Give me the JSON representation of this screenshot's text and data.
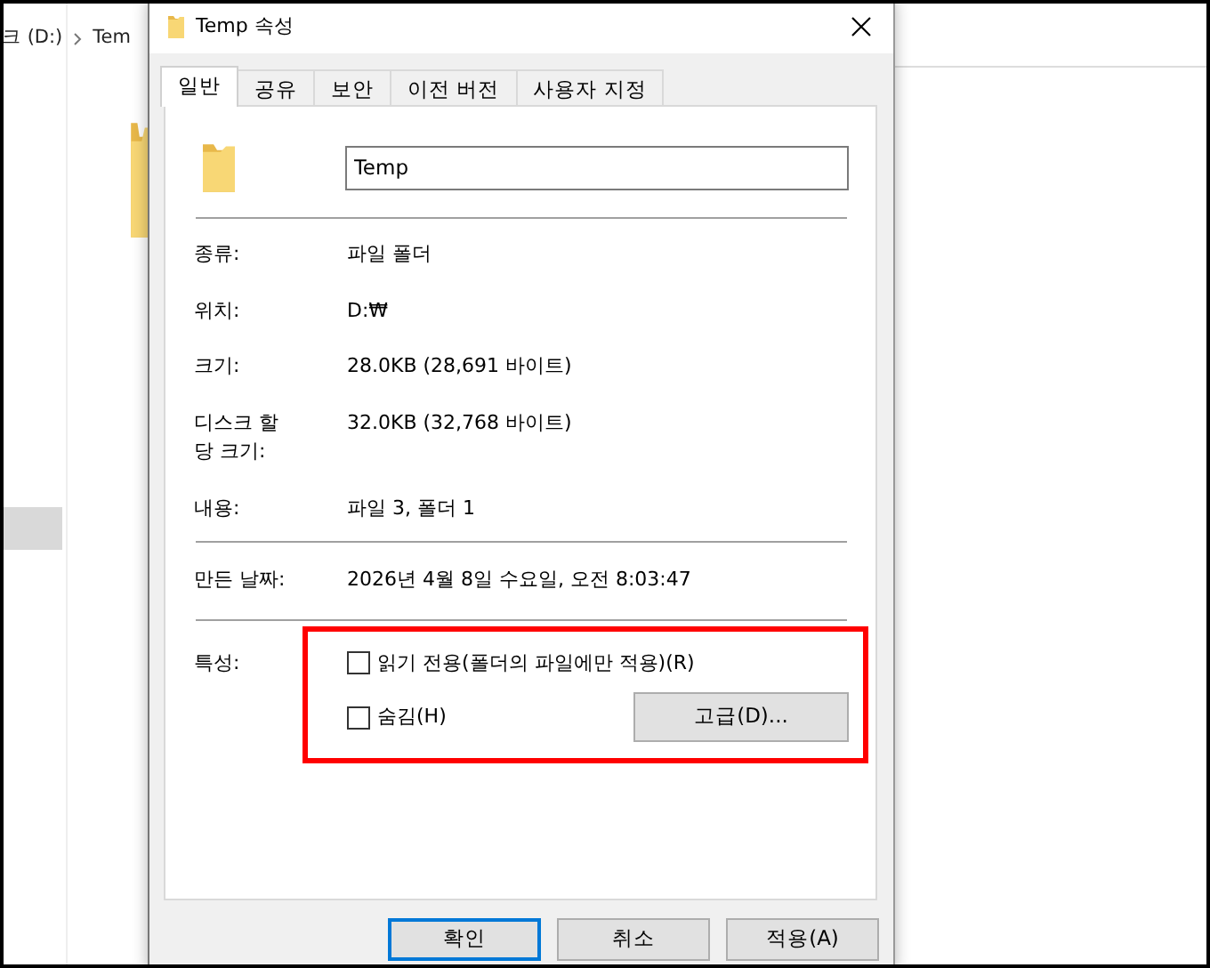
{
  "explorer": {
    "breadcrumb": [
      "크 (D:)",
      "Tem"
    ],
    "nav_items": [
      {
        "selected": true
      }
    ]
  },
  "dialog": {
    "title": "Temp 속성",
    "tabs": [
      {
        "label": "일반",
        "selected": true
      },
      {
        "label": "공유",
        "selected": false
      },
      {
        "label": "보안",
        "selected": false
      },
      {
        "label": "이전 버전",
        "selected": false
      },
      {
        "label": "사용자 지정",
        "selected": false
      }
    ],
    "name_field": {
      "value": "Temp"
    },
    "groups": [
      [
        {
          "label": "종류:",
          "value": "파일 폴더"
        },
        {
          "label": "위치:",
          "value": "D:₩"
        },
        {
          "label": "크기:",
          "value": "28.0KB (28,691 바이트)"
        },
        {
          "label": "디스크 할 당 크기:",
          "value": "32.0KB (32,768 바이트)"
        },
        {
          "label": "내용:",
          "value": "파일 3, 폴더 1"
        }
      ],
      [
        {
          "label": "만든 날짜:",
          "value": "2026년 4월 8일 수요일, 오전 8:03:47"
        }
      ]
    ],
    "attributes": {
      "label": "특성:",
      "checkboxes": [
        {
          "label": "읽기 전용(폴더의 파일에만 적용)(R)",
          "checked": false
        },
        {
          "label": "숨김(H)",
          "checked": false
        }
      ],
      "advanced_button": "고급(D)..."
    },
    "buttons": [
      {
        "label": "확인",
        "default": true
      },
      {
        "label": "취소",
        "default": false
      },
      {
        "label": "적용(A)",
        "default": false
      }
    ]
  }
}
